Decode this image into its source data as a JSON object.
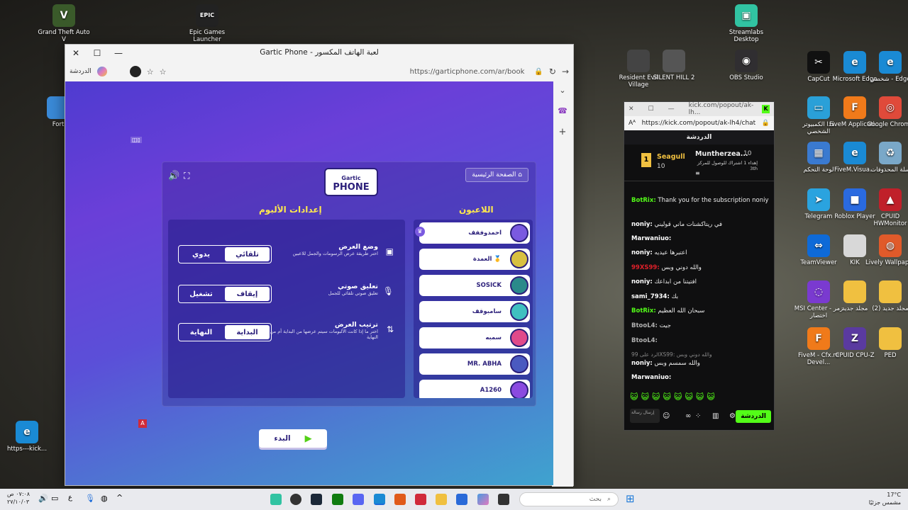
{
  "desktop_icons": [
    {
      "label": "Grand Theft Auto V",
      "icon": "gta-icon",
      "color": "#3a5a2a",
      "glyph": "V"
    },
    {
      "label": "Epic Games Launcher",
      "icon": "epic-icon",
      "color": "#222222",
      "glyph": "EPIC"
    },
    {
      "label": "Streamlabs Desktop",
      "icon": "streamlabs-icon",
      "color": "#31c3a2",
      "glyph": "▣"
    },
    {
      "label": "Resident Evil Village",
      "icon": "re-village-icon",
      "color": "#444444",
      "glyph": ""
    },
    {
      "label": "SILENT HILL 2",
      "icon": "silent-hill-icon",
      "color": "#555555",
      "glyph": ""
    },
    {
      "label": "OBS Studio",
      "icon": "obs-icon",
      "color": "#302e31",
      "glyph": "◉"
    },
    {
      "label": "CapCut",
      "icon": "capcut-icon",
      "color": "#111111",
      "glyph": "✂"
    },
    {
      "label": "Microsoft Edge",
      "icon": "edge-icon",
      "color": "#1a8ad4",
      "glyph": "e"
    },
    {
      "label": "شخصي - Edge",
      "icon": "edge-personal-icon",
      "color": "#1a8ad4",
      "glyph": "e"
    },
    {
      "label": "هذا الكمبيوتر الشخصي",
      "icon": "computer-icon",
      "color": "#2aa0d8",
      "glyph": "▭"
    },
    {
      "label": "FiveM Applicati...",
      "icon": "fivem-icon",
      "color": "#f07a1a",
      "glyph": "F"
    },
    {
      "label": "Google Chrome",
      "icon": "chrome-icon",
      "color": "#e04a3a",
      "glyph": "◎"
    },
    {
      "label": "لوحة التحكم",
      "icon": "control-panel-icon",
      "color": "#3a7ad0",
      "glyph": "▦"
    },
    {
      "label": "FiveM.Visua...",
      "icon": "fivem-visual-icon",
      "color": "#1a8ad4",
      "glyph": "e"
    },
    {
      "label": "سلة المحذوفات",
      "icon": "recycle-bin-icon",
      "color": "#7aa8c8",
      "glyph": "♻"
    },
    {
      "label": "Telegram",
      "icon": "telegram-icon",
      "color": "#2aa3df",
      "glyph": "➤"
    },
    {
      "label": "Roblox Player",
      "icon": "roblox-icon",
      "color": "#2a6ae0",
      "glyph": "■"
    },
    {
      "label": "CPUID HWMonitor",
      "icon": "hwmonitor-icon",
      "color": "#c0202a",
      "glyph": "▲"
    },
    {
      "label": "TeamViewer",
      "icon": "teamviewer-icon",
      "color": "#0e6ad8",
      "glyph": "⇔"
    },
    {
      "label": "KIK",
      "icon": "kik-icon",
      "color": "#d8d8d8",
      "glyph": ""
    },
    {
      "label": "Lively Wallpaper",
      "icon": "lively-icon",
      "color": "#e05a2a",
      "glyph": "◍"
    },
    {
      "label": "MSI Center - زمر اختصار",
      "icon": "msi-icon",
      "color": "#7a3ad0",
      "glyph": "◌"
    },
    {
      "label": "مجلد جديد",
      "icon": "folder-icon",
      "color": "#f0c040",
      "glyph": ""
    },
    {
      "label": "مجلد جديد (2)",
      "icon": "folder-icon",
      "color": "#f0c040",
      "glyph": ""
    },
    {
      "label": "FiveM - Cfx.re Devel...",
      "icon": "fivem-cfx-icon",
      "color": "#f07a1a",
      "glyph": "F"
    },
    {
      "label": "CPUID CPU-Z",
      "icon": "cpuz-icon",
      "color": "#5a3aa0",
      "glyph": "Z"
    },
    {
      "label": "PED",
      "icon": "folder-icon",
      "color": "#f0c040",
      "glyph": ""
    },
    {
      "label": "Fort",
      "icon": "fortnite-icon",
      "color": "#3a8ad8",
      "glyph": ""
    },
    {
      "label": "https---kick...",
      "icon": "edge-shortcut-icon",
      "color": "#1a8ad4",
      "glyph": "e"
    }
  ],
  "browser": {
    "title": "Gartic Phone - لعبة الهاتف المكسور",
    "url": "https://garticphone.com/ar/book",
    "copilot_label": "الدردشة"
  },
  "game": {
    "logo_top": "Gartic",
    "logo_bottom": "PHONE",
    "home_button": "الصفحة الرئيسية",
    "album_settings_title": "إعدادات الألبوم",
    "players_title": "اللاعبون",
    "settings": [
      {
        "title": "وضع العرض",
        "desc": "اختر طريقة عرض الرسومات والجمل للاعبين",
        "on": "تلقائي",
        "off": "يدوي",
        "icon": "image-icon",
        "glyph": "▣"
      },
      {
        "title": "تعليق صوتي",
        "desc": "تعليق صوتي تلقائي للجمل",
        "on": "إيقاف",
        "off": "تشغيل",
        "icon": "microphone-icon",
        "glyph": "🎙"
      },
      {
        "title": "ترتيب العرض",
        "desc": "اختر ما إذا كانت الألبومات سيتم عرضها من البداية أم من النهاية",
        "on": "البداية",
        "off": "النهاية",
        "icon": "sort-arrows-icon",
        "glyph": "⇅"
      }
    ],
    "start_button": "البدء",
    "players": [
      {
        "name": "احمدوففف",
        "color": "#7a5ae0"
      },
      {
        "name": "العمدة 🥇",
        "color": "#d8c040"
      },
      {
        "name": "SOSICK",
        "color": "#2a8a8a"
      },
      {
        "name": "سامبوقف",
        "color": "#40c0c0"
      },
      {
        "name": "سمبه",
        "color": "#e04a8a"
      },
      {
        "name": "MR. ABHA",
        "color": "#4a5ac0"
      },
      {
        "name": "A1260",
        "color": "#8a4ae0"
      }
    ]
  },
  "chat": {
    "window_url_short": "kick.com/popout/ak-lh...",
    "url": "https://kick.com/popout/ak-lh4/chat",
    "header": "الدردشة",
    "pinned_user_1": "Seagull",
    "pinned_count_1": "10",
    "pinned_user_2": "Muntherzea...",
    "pinned_count_2": "10",
    "pinned_text": "إهداء 1 اشتراك للوصول للمركز 3th",
    "messages": [
      {
        "user": "BotRix:",
        "text": "Thank you for the subscription noniy",
        "color": "#53fc18"
      },
      {
        "user": "noniy:",
        "text": "في ريتاكشنات ماني قوليني",
        "color": "#ffffff"
      },
      {
        "user": "Marwaniuo:",
        "text": "",
        "color": "#ffffff"
      },
      {
        "user": "noniy:",
        "text": "اعتبرها عيديه",
        "color": "#ffffff"
      },
      {
        "user": "99XS99:",
        "text": "والله دوني وبس",
        "color": "#e0202a"
      },
      {
        "user": "noniy:",
        "text": "افتيتنا من ابداعك",
        "color": "#ffffff"
      },
      {
        "user": "sami_7934:",
        "text": "بك",
        "color": "#ffffff"
      },
      {
        "user": "BotRix:",
        "text": "سبحان الله العظيم",
        "color": "#53fc18"
      },
      {
        "user": "BtooL4:",
        "text": "جيت",
        "color": "#b0b0b0"
      },
      {
        "user": "BtooL4:",
        "text": "",
        "color": "#b0b0b0"
      },
      {
        "user": "",
        "text": "الرد على 99XS99: والله دوني وبس",
        "color": "#888888"
      },
      {
        "user": "noniy:",
        "text": "والله سمسم وبس",
        "color": "#ffffff"
      },
      {
        "user": "Marwaniuo:",
        "text": "",
        "color": "#ffffff"
      }
    ],
    "send_label": "الدردشة",
    "input_placeholder": "إرسال رسالة"
  },
  "taskbar": {
    "time": "٠٧:٠٨ ص",
    "date": "٢٧/١٠/٠٣",
    "lang": "ع",
    "search_placeholder": "بحث",
    "weather_temp": "17°C",
    "weather_desc": "مشمس جزئيًا"
  }
}
